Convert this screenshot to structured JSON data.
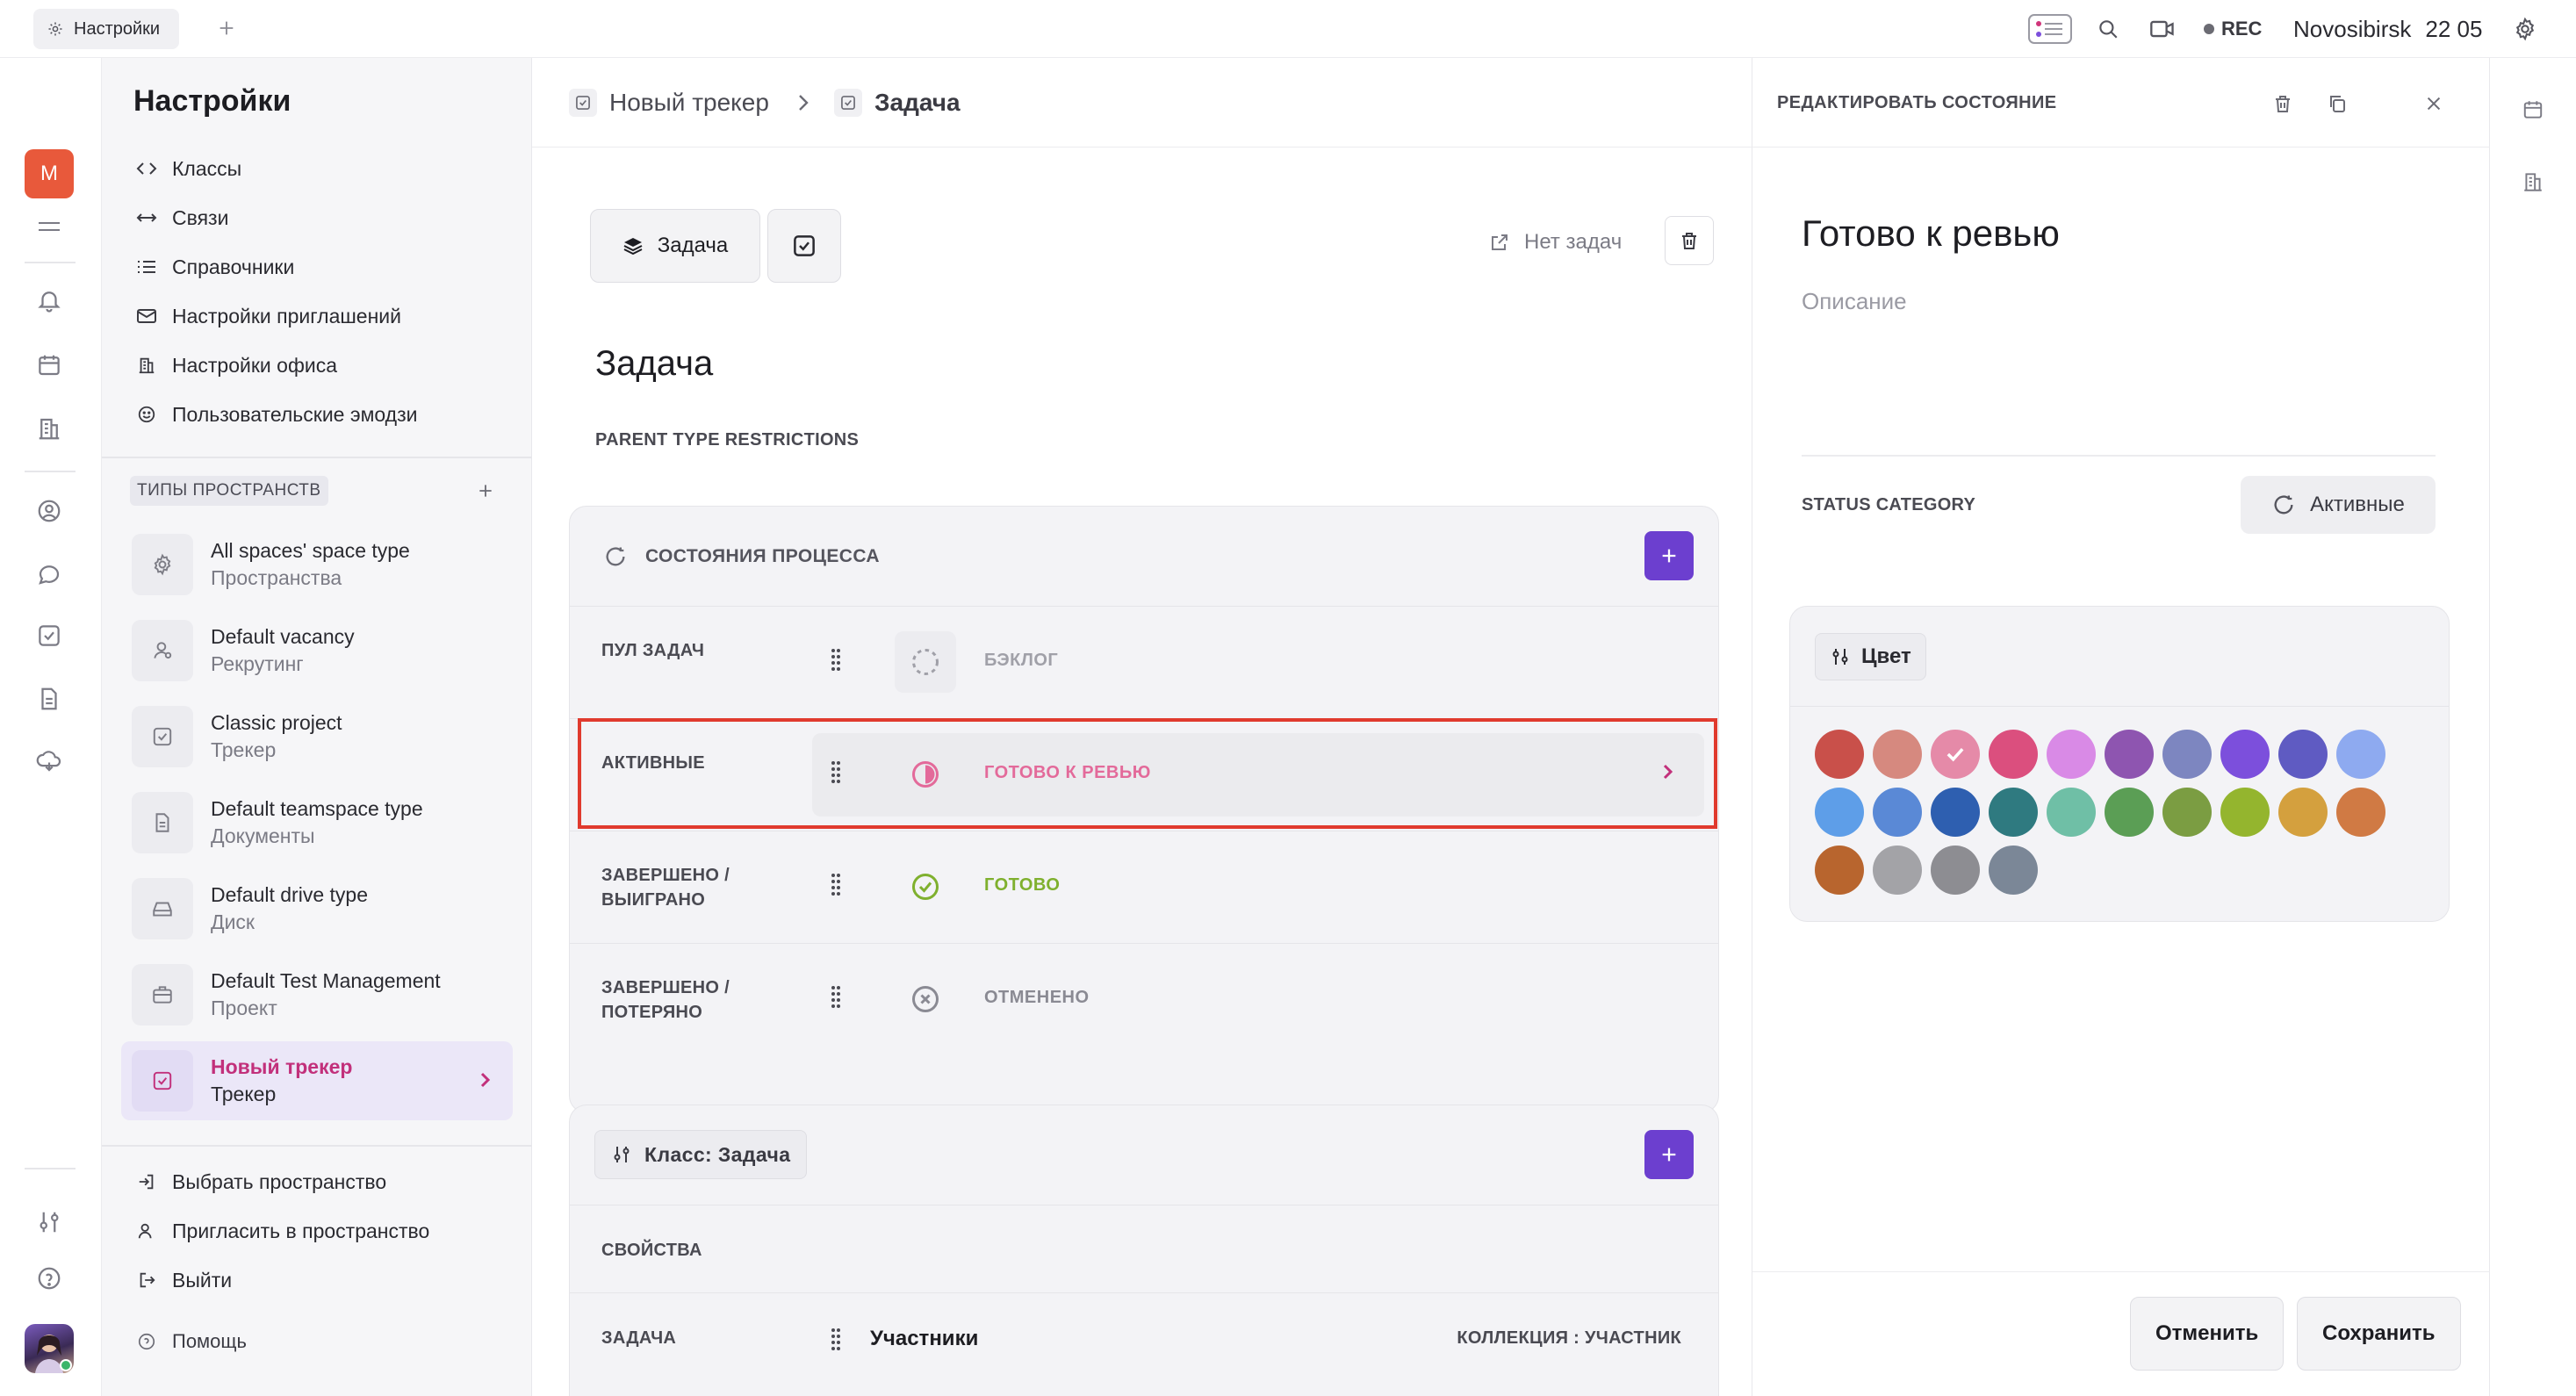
{
  "topbar": {
    "tab_label": "Настройки",
    "rec_label": "REC",
    "location": "Novosibirsk",
    "time": "22 05"
  },
  "rail": {
    "workspace_letter": "M"
  },
  "sidebar": {
    "title": "Настройки",
    "links": [
      {
        "label": "Классы",
        "icon": "code-icon"
      },
      {
        "label": "Связи",
        "icon": "arrows-icon"
      },
      {
        "label": "Справочники",
        "icon": "list-icon"
      },
      {
        "label": "Настройки приглашений",
        "icon": "mail-icon"
      },
      {
        "label": "Настройки офиса",
        "icon": "building-icon"
      },
      {
        "label": "Пользовательские эмодзи",
        "icon": "smile-icon"
      }
    ],
    "section_title": "ТИПЫ ПРОСТРАНСТВ",
    "spaces": [
      {
        "name": "All spaces' space type",
        "type": "Пространства",
        "icon": "gear-icon"
      },
      {
        "name": "Default vacancy",
        "type": "Рекрутинг",
        "icon": "person-icon"
      },
      {
        "name": "Classic project",
        "type": "Трекер",
        "icon": "check-icon"
      },
      {
        "name": "Default teamspace type",
        "type": "Документы",
        "icon": "document-icon"
      },
      {
        "name": "Default drive type",
        "type": "Диск",
        "icon": "drive-icon"
      },
      {
        "name": "Default Test Management",
        "type": "Проект",
        "icon": "briefcase-icon"
      },
      {
        "name": "Новый трекер",
        "type": "Трекер",
        "icon": "check-icon"
      }
    ],
    "bottom_links": [
      {
        "label": "Выбрать пространство"
      },
      {
        "label": "Пригласить в пространство"
      },
      {
        "label": "Выйти"
      }
    ],
    "help_label": "Помощь"
  },
  "main": {
    "crumb_1": "Новый трекер",
    "crumb_2": "Задача",
    "task_button": "Задача",
    "no_tasks": "Нет задач",
    "title": "Задача",
    "subtitle": "PARENT TYPE RESTRICTIONS",
    "states_header": "СОСТОЯНИЯ ПРОЦЕССА",
    "states": [
      {
        "group": "ПУЛ ЗАДАЧ",
        "name": "БЭКЛОГ",
        "color": "#a0a0a8"
      },
      {
        "group": "АКТИВНЫЕ",
        "name": "ГОТОВО К РЕВЬЮ",
        "color": "#e36a9a"
      },
      {
        "group_l1": "ЗАВЕРШЕНО /",
        "group_l2": "ВЫИГРАНО",
        "name": "ГОТОВО",
        "color": "#7fb02e"
      },
      {
        "group_l1": "ЗАВЕРШЕНО /",
        "group_l2": "ПОТЕРЯНО",
        "name": "ОТМЕНЕНО",
        "color": "#8a8a93"
      }
    ],
    "class_pill": "Класс: Задача",
    "properties_label": "СВОЙСТВА",
    "prop_row": {
      "label": "ЗАДАЧА",
      "value": "Участники",
      "type": "КОЛЛЕКЦИЯ : УЧАСТНИК"
    }
  },
  "panel": {
    "header": "РЕДАКТИРОВАТЬ СОСТОЯНИЕ",
    "name": "Готово к ревью",
    "description_placeholder": "Описание",
    "category_label": "STATUS CATEGORY",
    "category_value": "Активные",
    "color_button": "Цвет",
    "colors": [
      "#c9504a",
      "#d6897f",
      "#e58aa8",
      "#db4f7e",
      "#d98ae6",
      "#8e55b0",
      "#7d86c0",
      "#7c4fdc",
      "#5f5bc2",
      "#8eaaf0",
      "#5e9ee8",
      "#5a89d6",
      "#2e5fb0",
      "#2f7a80",
      "#6fbfa6",
      "#5b9e55",
      "#7b9d42",
      "#94b52e",
      "#d4a03e",
      "#d07a44",
      "#b8652e",
      "#a3a3a7",
      "#8d8d92",
      "#7b8797"
    ],
    "selected_color_index": 2,
    "cancel": "Отменить",
    "save": "Сохранить"
  }
}
